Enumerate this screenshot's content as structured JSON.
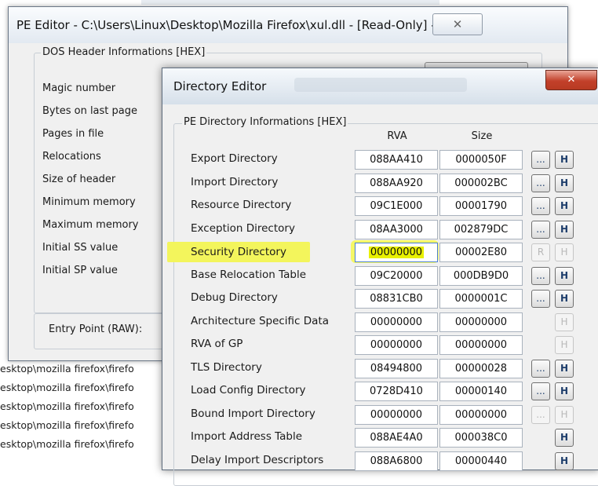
{
  "background_log": {
    "lines": [
      "esktop\\mozilla firefox\\firefo",
      "esktop\\mozilla firefox\\firefo",
      "esktop\\mozilla firefox\\firefo",
      "esktop\\mozilla firefox\\firefo",
      "esktop\\mozilla firefox\\firefo"
    ]
  },
  "pe_editor": {
    "title": "PE Editor - C:\\Users\\Linux\\Desktop\\Mozilla Firefox\\xul.dll - [Read-Only] - ...",
    "close_glyph": "✕",
    "dos_header": {
      "legend": "DOS Header Informations [HEX]",
      "fields": [
        "Magic number",
        "Bytes on last page",
        "Pages in file",
        "Relocations",
        "Size of header",
        "Minimum memory",
        "Maximum memory",
        "Initial SS value",
        "Initial SP value"
      ]
    },
    "entry_point_label": "Entry Point (RAW):"
  },
  "directory_editor": {
    "title": "Directory Editor",
    "close_glyph": "✕",
    "group_legend": "PE Directory Informations [HEX]",
    "columns": {
      "rva": "RVA",
      "size": "Size"
    },
    "rows": [
      {
        "name": "Export Directory",
        "rva": "088AA410",
        "size": "0000050F",
        "dot": "...",
        "h": "H",
        "dot_state": "enabled",
        "h_state": "enabled"
      },
      {
        "name": "Import Directory",
        "rva": "088AA920",
        "size": "000002BC",
        "dot": "...",
        "h": "H",
        "dot_state": "enabled",
        "h_state": "enabled"
      },
      {
        "name": "Resource Directory",
        "rva": "09C1E000",
        "size": "00001790",
        "dot": "...",
        "h": "H",
        "dot_state": "enabled",
        "h_state": "enabled"
      },
      {
        "name": "Exception Directory",
        "rva": "08AA3000",
        "size": "002879DC",
        "dot": "...",
        "h": "H",
        "dot_state": "enabled",
        "h_state": "enabled"
      },
      {
        "name": "Security Directory",
        "rva": "00000000",
        "size": "00002E80",
        "dot": "R",
        "h": "H",
        "dot_state": "disabled",
        "h_state": "disabled",
        "highlighted": true
      },
      {
        "name": "Base Relocation Table",
        "rva": "09C20000",
        "size": "000DB9D0",
        "dot": "...",
        "h": "H",
        "dot_state": "enabled",
        "h_state": "enabled"
      },
      {
        "name": "Debug Directory",
        "rva": "08831CB0",
        "size": "0000001C",
        "dot": "...",
        "h": "H",
        "dot_state": "enabled",
        "h_state": "enabled"
      },
      {
        "name": "Architecture Specific Data",
        "rva": "00000000",
        "size": "00000000",
        "dot": "",
        "h": "H",
        "dot_state": "hidden",
        "h_state": "disabled"
      },
      {
        "name": "RVA of GP",
        "rva": "00000000",
        "size": "00000000",
        "dot": "",
        "h": "H",
        "dot_state": "hidden",
        "h_state": "disabled"
      },
      {
        "name": "TLS Directory",
        "rva": "08494800",
        "size": "00000028",
        "dot": "...",
        "h": "H",
        "dot_state": "enabled",
        "h_state": "enabled"
      },
      {
        "name": "Load Config Directory",
        "rva": "0728D410",
        "size": "00000140",
        "dot": "...",
        "h": "H",
        "dot_state": "enabled",
        "h_state": "enabled"
      },
      {
        "name": "Bound Import Directory",
        "rva": "00000000",
        "size": "00000000",
        "dot": "...",
        "h": "H",
        "dot_state": "disabled",
        "h_state": "disabled"
      },
      {
        "name": "Import Address Table",
        "rva": "088AE4A0",
        "size": "000038C0",
        "dot": "",
        "h": "H",
        "dot_state": "hidden",
        "h_state": "enabled"
      },
      {
        "name": "Delay Import Descriptors",
        "rva": "088A6800",
        "size": "00000440",
        "dot": "",
        "h": "H",
        "dot_state": "hidden",
        "h_state": "enabled"
      }
    ]
  }
}
